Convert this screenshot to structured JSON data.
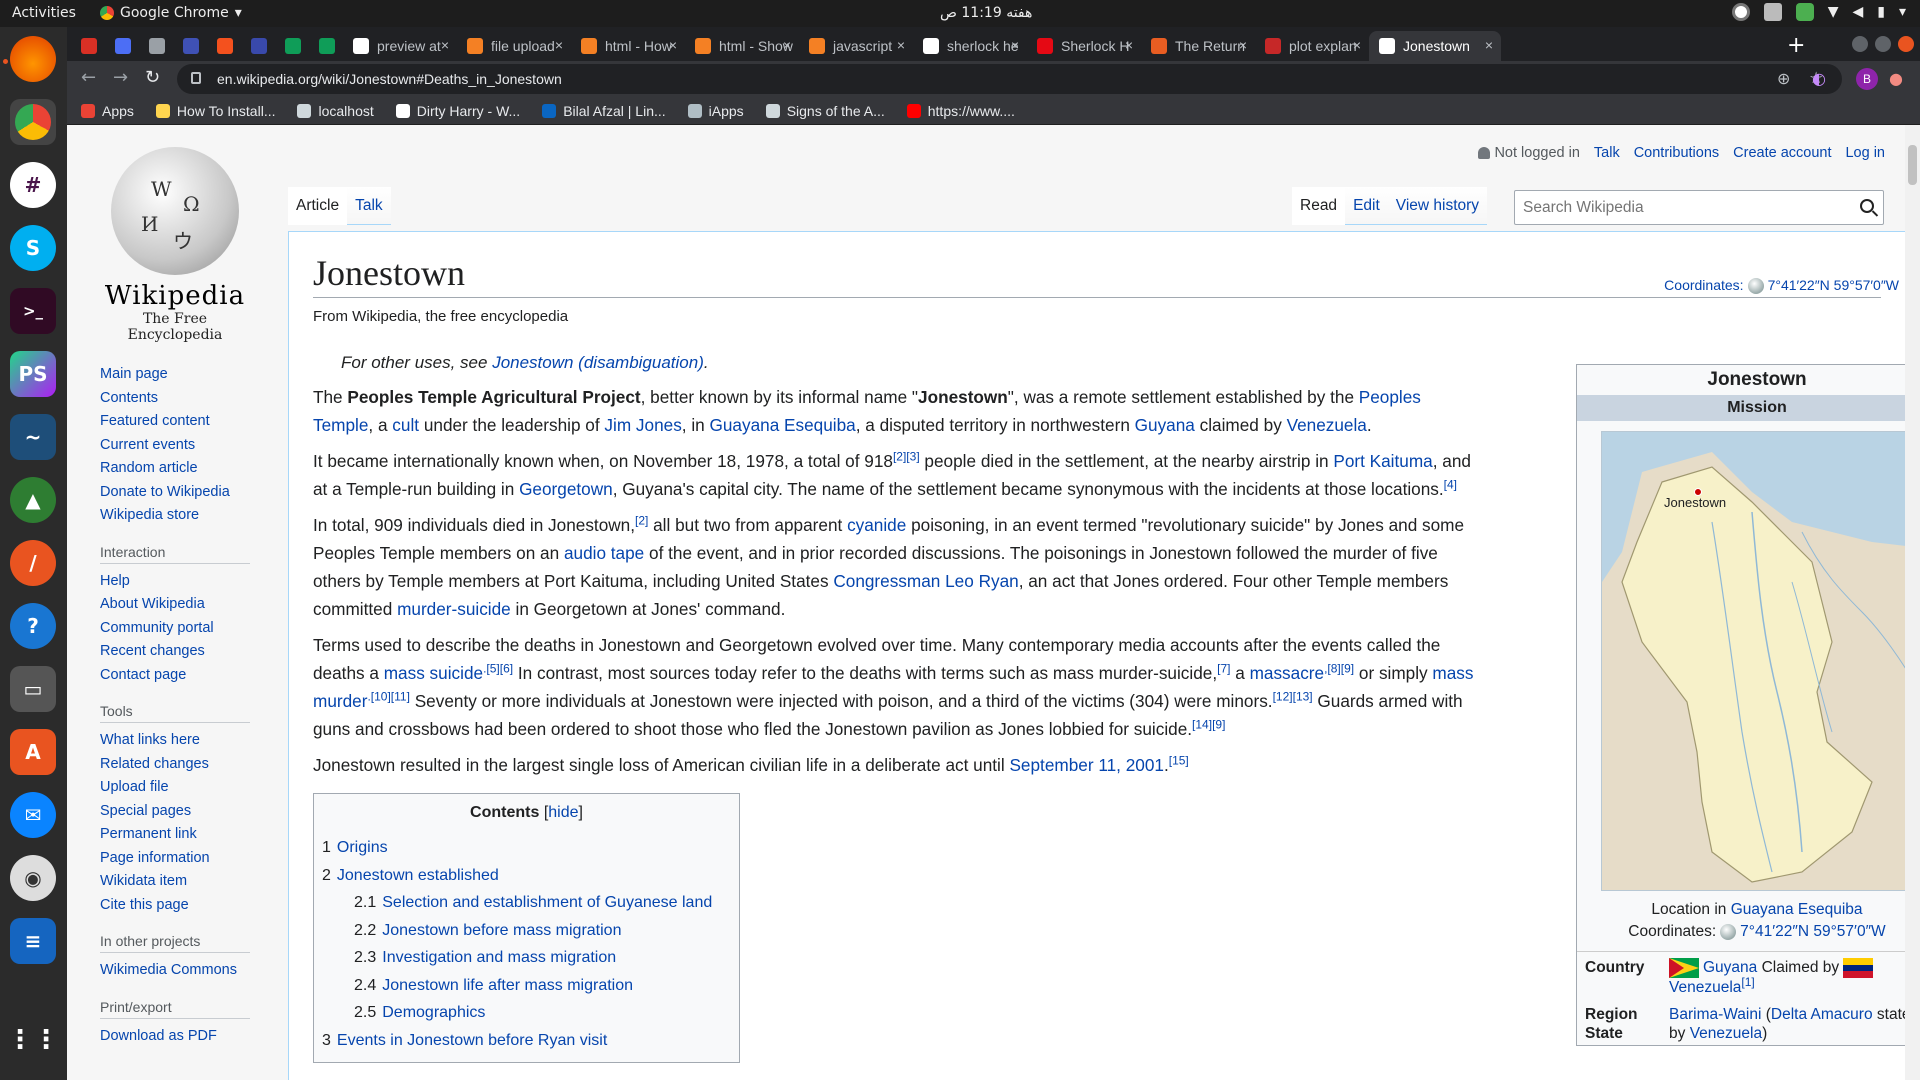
{
  "os": {
    "activities": "Activities",
    "app_name": "Google Chrome",
    "clock": "هفته 11:19 ص"
  },
  "browser": {
    "tabs": [
      {
        "title": "",
        "color": "#d93025"
      },
      {
        "title": "",
        "color": "#4c6ef5"
      },
      {
        "title": "",
        "color": "#9aa0a6"
      },
      {
        "title": "",
        "color": "#3f51b5"
      },
      {
        "title": "",
        "color": "#f4511e"
      },
      {
        "title": "",
        "color": "#3949ab"
      },
      {
        "title": "",
        "color": "#0f9d58"
      },
      {
        "title": "",
        "color": "#0f9d58"
      },
      {
        "title": "preview at",
        "color": "#ffffff"
      },
      {
        "title": "file upload",
        "color": "#f48024"
      },
      {
        "title": "html - How",
        "color": "#f48024"
      },
      {
        "title": "html - Show",
        "color": "#f48024"
      },
      {
        "title": "javascript",
        "color": "#f48024"
      },
      {
        "title": "sherlock he",
        "color": "#ffffff"
      },
      {
        "title": "Sherlock H",
        "color": "#e50914"
      },
      {
        "title": "The Return",
        "color": "#e85d22"
      },
      {
        "title": "plot explan",
        "color": "#c62828"
      },
      {
        "title": "Jonestown",
        "color": "#ffffff"
      }
    ],
    "url": "en.wikipedia.org/wiki/Jonestown#Deaths_in_Jonestown",
    "bookmarks": [
      {
        "label": "Apps",
        "color": "#ea4335"
      },
      {
        "label": "How To Install...",
        "color": "#ffd54f"
      },
      {
        "label": "localhost",
        "color": "#cfd8dc"
      },
      {
        "label": "Dirty Harry - W...",
        "color": "#ffffff"
      },
      {
        "label": "Bilal Afzal | Lin...",
        "color": "#0a66c2"
      },
      {
        "label": "iApps",
        "color": "#b0bec5"
      },
      {
        "label": "Signs of the A...",
        "color": "#cfd8dc"
      },
      {
        "label": "https://www....",
        "color": "#ff0000"
      }
    ]
  },
  "wiki": {
    "wordmark": "Wikipedia",
    "tagline": "The Free Encyclopedia",
    "personal": {
      "not_logged": "Not logged in",
      "talk": "Talk",
      "contributions": "Contributions",
      "create": "Create account",
      "login": "Log in"
    },
    "tabs": {
      "article": "Article",
      "talk": "Talk",
      "read": "Read",
      "edit": "Edit",
      "history": "View history"
    },
    "search_placeholder": "Search Wikipedia",
    "nav": [
      "Main page",
      "Contents",
      "Featured content",
      "Current events",
      "Random article",
      "Donate to Wikipedia",
      "Wikipedia store"
    ],
    "interaction_h": "Interaction",
    "interaction": [
      "Help",
      "About Wikipedia",
      "Community portal",
      "Recent changes",
      "Contact page"
    ],
    "tools_h": "Tools",
    "tools": [
      "What links here",
      "Related changes",
      "Upload file",
      "Special pages",
      "Permanent link",
      "Page information",
      "Wikidata item",
      "Cite this page"
    ],
    "projects_h": "In other projects",
    "projects": [
      "Wikimedia Commons"
    ],
    "print_h": "Print/export",
    "print": [
      "Download as PDF"
    ]
  },
  "article": {
    "title": "Jonestown",
    "site_sub": "From Wikipedia, the free encyclopedia",
    "coords_label": "Coordinates:",
    "coords": "7°41′22″N 59°57′0″W",
    "hatnote_pre": "For other uses, see ",
    "hatnote_link": "Jonestown (disambiguation)",
    "hatnote_post": ".",
    "p1": {
      "a": "The ",
      "b": "Peoples Temple Agricultural Project",
      "c": ", better known by its informal name \"",
      "d": "Jonestown",
      "e": "\", was a remote settlement established by the ",
      "f": "Peoples Temple",
      "g": ", a ",
      "h": "cult",
      "i": " under the leadership of ",
      "j": "Jim Jones",
      "k": ", in ",
      "l": "Guayana Esequiba",
      "m": ", a disputed territory in northwestern ",
      "n": "Guyana",
      "o": " claimed by ",
      "p": "Venezuela",
      "q": "."
    },
    "p2": {
      "a": "It became internationally known when, on November 18, 1978, a total of 918",
      "s1": "[2][3]",
      "b": " people died in the settlement, at the nearby airstrip in ",
      "c": "Port Kaituma",
      "d": ", and at a Temple-run building in ",
      "e": "Georgetown",
      "f": ", Guyana's capital city. The name of the settlement became synonymous with the incidents at those locations.",
      "s2": "[4]"
    },
    "p3": {
      "a": "In total, 909 individuals died in Jonestown,",
      "s1": "[2]",
      "b": " all but two from apparent ",
      "c": "cyanide",
      "d": " poisoning, in an event termed \"revolutionary suicide\" by Jones and some Peoples Temple members on an ",
      "e": "audio tape",
      "f": " of the event, and in prior recorded discussions. The poisonings in Jonestown followed the murder of five others by Temple members at Port Kaituma, including United States ",
      "g": "Congressman Leo Ryan",
      "h": ", an act that Jones ordered. Four other Temple members committed ",
      "i": "murder-suicide",
      "j": " in Georgetown at Jones' command."
    },
    "p4": {
      "a": "Terms used to describe the deaths in Jonestown and Georgetown evolved over time. Many contemporary media accounts after the events called the deaths a ",
      "b": "mass suicide",
      "s1": ".[5][6]",
      "c": " In contrast, most sources today refer to the deaths with terms such as mass murder-suicide,",
      "s2": "[7]",
      "d": " a ",
      "e": "massacre",
      "s3": ",[8][9]",
      "f": " or simply ",
      "g": "mass murder",
      "s4": ".[10][11]",
      "h": " Seventy or more individuals at Jonestown were injected with poison, and a third of the victims (304) were minors.",
      "s5": "[12][13]",
      "i": " Guards armed with guns and crossbows had been ordered to shoot those who fled the Jonestown pavilion as Jones lobbied for suicide.",
      "s6": "[14][9]"
    },
    "p5": {
      "a": "Jonestown resulted in the largest single loss of American civilian life in a deliberate act until ",
      "b": "September 11, 2001",
      "c": ".",
      "s1": "[15]"
    },
    "toc": {
      "title": "Contents",
      "hide": "hide",
      "items": [
        {
          "num": "1",
          "label": "Origins",
          "sub": false
        },
        {
          "num": "2",
          "label": "Jonestown established",
          "sub": false
        },
        {
          "num": "2.1",
          "label": "Selection and establishment of Guyanese land",
          "sub": true
        },
        {
          "num": "2.2",
          "label": "Jonestown before mass migration",
          "sub": true
        },
        {
          "num": "2.3",
          "label": "Investigation and mass migration",
          "sub": true
        },
        {
          "num": "2.4",
          "label": "Jonestown life after mass migration",
          "sub": true
        },
        {
          "num": "2.5",
          "label": "Demographics",
          "sub": true
        },
        {
          "num": "3",
          "label": "Events in Jonestown before Ryan visit",
          "sub": false
        }
      ]
    }
  },
  "infobox": {
    "title": "Jonestown",
    "subtitle": "Mission",
    "map_label": "Jonestown",
    "caption_pre": "Location in ",
    "caption_link": "Guayana Esequiba",
    "coords_label": "Coordinates:",
    "coords": "7°41′22″N 59°57′0″W",
    "country_k": "Country",
    "country_link": "Guyana",
    "country_mid": " Claimed by ",
    "country_link2": "Venezuela",
    "country_sup": "[1]",
    "region_k": "Region State",
    "region_link": "Barima-Waini",
    "region_paren_open": " (",
    "region_link2": "Delta Amacuro",
    "region_mid": " state by ",
    "region_link3": "Venezuela",
    "region_end": ")"
  }
}
